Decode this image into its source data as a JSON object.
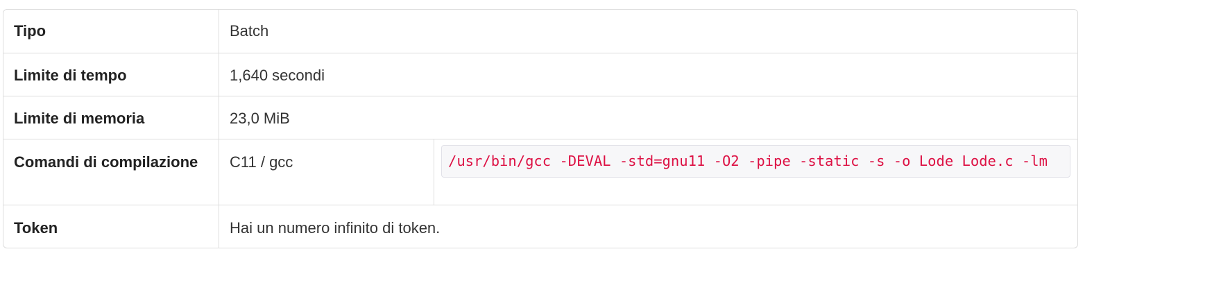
{
  "rows": [
    {
      "label": "Tipo",
      "value": "Batch"
    },
    {
      "label": "Limite di tempo",
      "value": "1,640 secondi"
    },
    {
      "label": "Limite di memoria",
      "value": "23,0 MiB"
    },
    {
      "label": "Comandi di compilazione",
      "language": "C11 / gcc",
      "command": "/usr/bin/gcc -DEVAL -std=gnu11 -O2 -pipe -static -s -o Lode Lode.c -lm"
    },
    {
      "label": "Token",
      "value": "Hai un numero infinito di token."
    }
  ],
  "colors": {
    "border": "#dddddd",
    "code_text": "#dd1144",
    "code_background": "#f7f7f9"
  }
}
